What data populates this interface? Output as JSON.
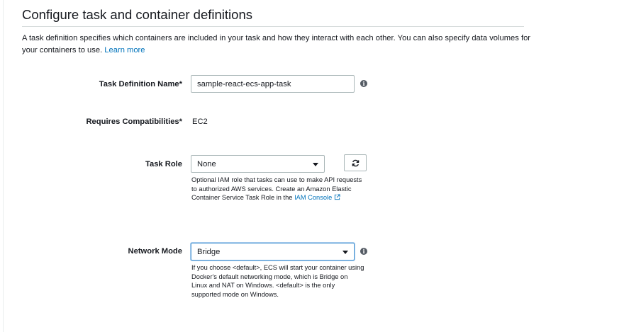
{
  "section": {
    "title": "Configure task and container definitions",
    "description": "A task definition specifies which containers are included in your task and how they interact with each other. You can also specify data volumes for your containers to use.",
    "learn_more": "Learn more"
  },
  "fields": {
    "task_definition_name": {
      "label": "Task Definition Name*",
      "value": "sample-react-ecs-app-task"
    },
    "requires_compatibilities": {
      "label": "Requires Compatibilities*",
      "value": "EC2"
    },
    "task_role": {
      "label": "Task Role",
      "selected": "None",
      "help": "Optional IAM role that tasks can use to make API requests to authorized AWS services. Create an Amazon Elastic Container Service Task Role in the",
      "help_link": "IAM Console"
    },
    "network_mode": {
      "label": "Network Mode",
      "selected": "Bridge",
      "help": "If you choose <default>, ECS will start your container using Docker's default networking mode, which is Bridge on Linux and NAT on Windows. <default> is the only supported mode on Windows."
    }
  },
  "icons": {
    "info": "info-icon",
    "refresh": "refresh-icon",
    "external_link": "external-link-icon",
    "dropdown": "chevron-down-icon"
  },
  "colors": {
    "link": "#0073bb",
    "focus_border": "#5a9fd6"
  }
}
